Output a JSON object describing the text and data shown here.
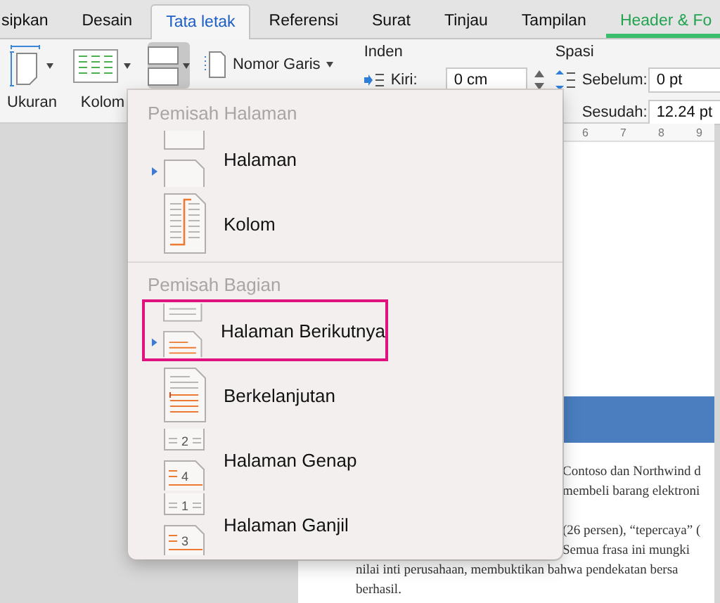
{
  "tabs": [
    {
      "label": "sipkan",
      "selected": false,
      "kind": "normal"
    },
    {
      "label": "Desain",
      "selected": false,
      "kind": "normal"
    },
    {
      "label": "Tata letak",
      "selected": true,
      "kind": "normal"
    },
    {
      "label": "Referensi",
      "selected": false,
      "kind": "normal"
    },
    {
      "label": "Surat",
      "selected": false,
      "kind": "normal"
    },
    {
      "label": "Tinjau",
      "selected": false,
      "kind": "normal"
    },
    {
      "label": "Tampilan",
      "selected": false,
      "kind": "normal"
    },
    {
      "label": "Header & Fo",
      "selected": false,
      "kind": "contextual"
    }
  ],
  "ribbon": {
    "size_label": "Ukuran",
    "columns_label": "Kolom",
    "breaks_selected": true,
    "line_numbers_label": "Nomor Garis",
    "indent": {
      "title": "Inden",
      "left_label": "Kiri:",
      "left_value": "0 cm"
    },
    "spacing": {
      "title": "Spasi",
      "before_label": "Sebelum:",
      "before_value": "0 pt",
      "after_label": "Sesudah:",
      "after_value": "12.24 pt"
    }
  },
  "ruler": [
    "6",
    "7",
    "8",
    "9"
  ],
  "document": {
    "right_paragraphs": [
      [
        "Contoso dan Northwind d",
        "membeli barang elektroni"
      ],
      [
        "(26 persen), “tepercaya” (",
        "Semua frasa ini mungki"
      ]
    ],
    "full_lines": [
      "nilai inti perusahaan, membuktikan bahwa pendekatan bersa",
      "berhasil."
    ]
  },
  "menu": {
    "sections": [
      {
        "title": "Pemisah Halaman",
        "items": [
          {
            "label": "Halaman",
            "kind": "page",
            "highlighted": false
          },
          {
            "label": "Kolom",
            "kind": "column",
            "highlighted": false
          }
        ]
      },
      {
        "title": "Pemisah Bagian",
        "items": [
          {
            "label": "Halaman Berikutnya",
            "kind": "next-page",
            "highlighted": true
          },
          {
            "label": "Berkelanjutan",
            "kind": "continuous",
            "highlighted": false
          },
          {
            "label": "Halaman Genap",
            "kind": "even",
            "numbers": [
              "2",
              "4"
            ],
            "highlighted": false
          },
          {
            "label": "Halaman Ganjil",
            "kind": "odd",
            "numbers": [
              "1",
              "3"
            ],
            "highlighted": false
          }
        ]
      }
    ]
  }
}
